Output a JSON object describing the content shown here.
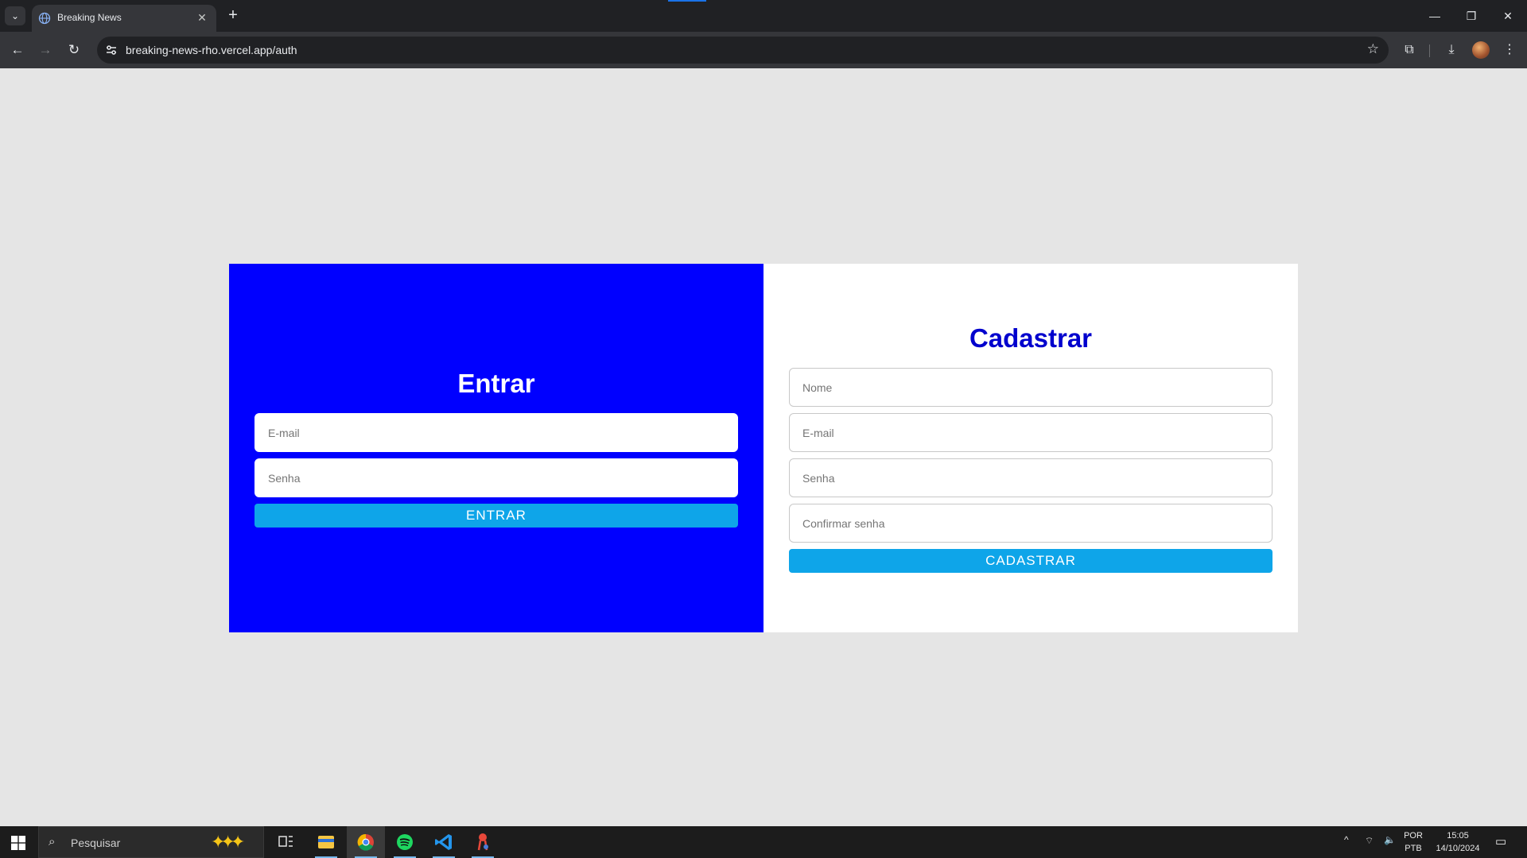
{
  "browser": {
    "tab_title": "Breaking News",
    "url": "breaking-news-rho.vercel.app/auth"
  },
  "signin": {
    "title": "Entrar",
    "email_placeholder": "E-mail",
    "password_placeholder": "Senha",
    "submit_label": "ENTRAR"
  },
  "signup": {
    "title": "Cadastrar",
    "name_placeholder": "Nome",
    "email_placeholder": "E-mail",
    "password_placeholder": "Senha",
    "confirm_placeholder": "Confirmar senha",
    "submit_label": "CADASTRAR"
  },
  "colors": {
    "signin_panel": "#0000ff",
    "signup_panel": "#ffffff",
    "signup_title": "#0000cd",
    "button": "#0ea5e9",
    "page_bg": "#e5e5e5"
  },
  "taskbar": {
    "search_placeholder": "Pesquisar",
    "apps": [
      "file-explorer-icon",
      "chrome-icon",
      "spotify-icon",
      "vscode-icon",
      "app-icon"
    ],
    "lang_line1": "POR",
    "lang_line2": "PTB",
    "time": "15:05",
    "date": "14/10/2024"
  }
}
